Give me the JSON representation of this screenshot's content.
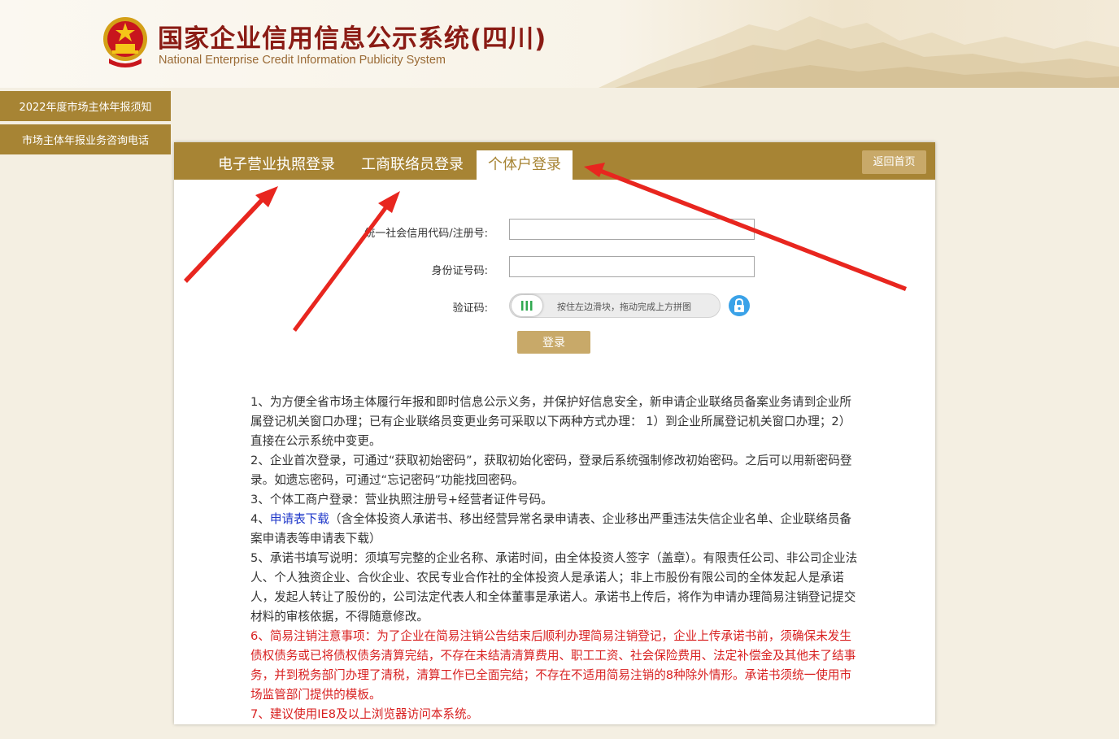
{
  "header": {
    "title": "国家企业信用信息公示系统(四川)",
    "subtitle": "National Enterprise Credit Information Publicity System",
    "emblem_icon": "national-emblem-icon"
  },
  "side_menu": {
    "items": [
      {
        "label": "2022年度市场主体年报须知"
      },
      {
        "label": "市场主体年报业务咨询电话"
      }
    ]
  },
  "tabs": [
    {
      "label": "电子营业执照登录",
      "active": false
    },
    {
      "label": "工商联络员登录",
      "active": false
    },
    {
      "label": "个体户登录",
      "active": true
    }
  ],
  "back_button": "返回首页",
  "form": {
    "credit_code_label": "统一社会信用代码/注册号:",
    "credit_code_value": "",
    "id_label": "身份证号码:",
    "id_value": "",
    "captcha_label": "验证码:",
    "slider_hint": "按住左边滑块，拖动完成上方拼图",
    "slider_knob_icon": "grip-bars-icon",
    "lock_icon": "lock-icon",
    "login_button": "登录"
  },
  "notes": {
    "n1": "1、为方便全省市场主体履行年报和即时信息公示义务，并保护好信息安全，新申请企业联络员备案业务请到企业所属登记机关窗口办理；已有企业联络员变更业务可采取以下两种方式办理： 1）到企业所属登记机关窗口办理；2）直接在公示系统中变更。",
    "n2": "2、企业首次登录，可通过“获取初始密码”，获取初始化密码，登录后系统强制修改初始密码。之后可以用新密码登录。如遗忘密码，可通过“忘记密码”功能找回密码。",
    "n3": "3、个体工商户登录：营业执照注册号+经营者证件号码。",
    "n4_prefix": "4、",
    "n4_link": "申请表下载",
    "n4_rest": "（含全体投资人承诺书、移出经营异常名录申请表、企业移出严重违法失信企业名单、企业联络员备案申请表等申请表下载）",
    "n5": "5、承诺书填写说明：须填写完整的企业名称、承诺时间，由全体投资人签字（盖章）。有限责任公司、非公司企业法人、个人独资企业、合伙企业、农民专业合作社的全体投资人是承诺人；非上市股份有限公司的全体发起人是承诺人，发起人转让了股份的，公司法定代表人和全体董事是承诺人。承诺书上传后，将作为申请办理简易注销登记提交材料的审核依据，不得随意修改。",
    "n6": "6、简易注销注意事项：为了企业在简易注销公告结束后顺利办理简易注销登记，企业上传承诺书前，须确保未发生债权债务或已将债权债务清算完结，不存在未结清清算费用、职工工资、社会保险费用、法定补偿金及其他未了结事务，并到税务部门办理了清税，清算工作已全面完结；不存在不适用简易注销的8种除外情形。承诺书须统一使用市场监管部门提供的模板。",
    "n7": "7、建议使用IE8及以上浏览器访问本系统。"
  },
  "colors": {
    "accent_gold": "#a78434",
    "light_gold": "#c8a969",
    "title_red": "#8a1b14",
    "warning_red": "#d82020",
    "link_blue": "#1d36c9",
    "annotation_arrow": "#e8261f"
  }
}
